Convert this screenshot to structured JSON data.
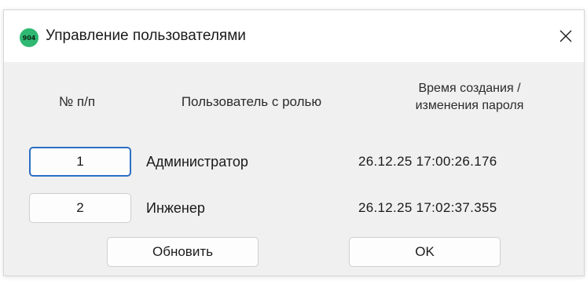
{
  "window": {
    "title": "Управление пользователями",
    "app_icon_text": "904",
    "close_glyph": "✕"
  },
  "table": {
    "headers": {
      "number": "№ п/п",
      "user": "Пользователь с ролью",
      "time_line1": "Время создания /",
      "time_line2": "изменения пароля"
    },
    "rows": [
      {
        "number": "1",
        "user": "Администратор",
        "time": "26.12.25 17:00:26.176"
      },
      {
        "number": "2",
        "user": "Инженер",
        "time": "26.12.25 17:02:37.355"
      }
    ]
  },
  "buttons": {
    "refresh": "Обновить",
    "ok": "OK"
  },
  "colors": {
    "app_icon": "#2fb872",
    "focus_border": "#2d6fc4",
    "window_bg": "#f0f0f0"
  }
}
